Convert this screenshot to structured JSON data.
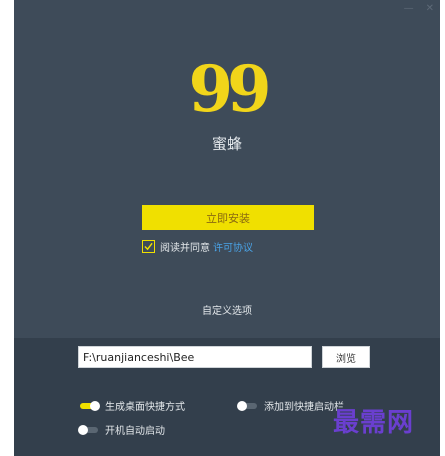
{
  "window": {
    "minimize_glyph": "—",
    "close_glyph": "✕"
  },
  "logo": {
    "glyph": "99",
    "icon": "quote-logo-icon",
    "color": "#f1d51a"
  },
  "app_name": "蜜蜂",
  "install_button": {
    "label": "立即安装",
    "color": "#f0e000"
  },
  "agreement": {
    "checked": true,
    "text": "阅读并同意",
    "link_text": "许可协议",
    "link_color": "#4aa3e6"
  },
  "custom_options": {
    "label": "自定义选项"
  },
  "install_path": {
    "value": "F:\\ruanjianceshi\\Bee",
    "browse_label": "浏览"
  },
  "options": [
    {
      "label": "生成桌面快捷方式",
      "enabled": true
    },
    {
      "label": "添加到快捷启动栏",
      "enabled": false
    },
    {
      "label": "开机自动启动",
      "enabled": false
    }
  ],
  "watermark": "最需网"
}
